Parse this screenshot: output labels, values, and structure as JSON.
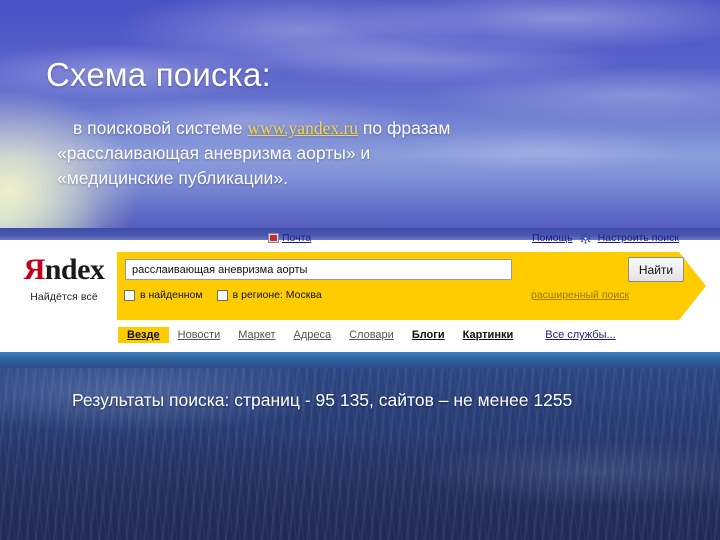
{
  "slide": {
    "title": "Схема поиска:",
    "body": {
      "line1_pre": "в поисковой системе ",
      "link": "www.yandex.ru",
      "line1_post": " по фразам",
      "line2": "«расслаивающая аневризма аорты» и",
      "line3": "«медицинские публикации»."
    },
    "caption": "Результаты поиска: страниц - 95 135, сайтов – не менее 1255"
  },
  "yandex": {
    "topbar": {
      "mail_icon": "mail-icon",
      "mail": "Почта",
      "help": "Помощь",
      "gear_icon": "gear-icon",
      "settings": "Настроить поиск"
    },
    "logo": {
      "ya": "Я",
      "ndex": "ndex",
      "tagline": "Найдётся всё"
    },
    "search": {
      "query": "расслаивающая аневризма аорты",
      "placeholder": "",
      "button": "Найти",
      "advanced": "расширенный поиск",
      "options": [
        {
          "label": "в найденном",
          "checked": false
        },
        {
          "label": "в регионе: Москва",
          "checked": false
        }
      ]
    },
    "nav": [
      {
        "label": "Везде",
        "state": "current"
      },
      {
        "label": "Новости",
        "state": "link"
      },
      {
        "label": "Маркет",
        "state": "link"
      },
      {
        "label": "Адреса",
        "state": "link"
      },
      {
        "label": "Словари",
        "state": "link"
      },
      {
        "label": "Блоги",
        "state": "strong"
      },
      {
        "label": "Картинки",
        "state": "strong"
      },
      {
        "label": "Все службы...",
        "state": "all"
      }
    ]
  },
  "colors": {
    "yandex_yellow": "#ffcc00",
    "logo_red": "#c3001b",
    "link_blue": "#1d1d8a",
    "slide_link_gold": "#f4d64a",
    "sky_blue": "#5159c8",
    "sea_navy": "#283b72"
  }
}
